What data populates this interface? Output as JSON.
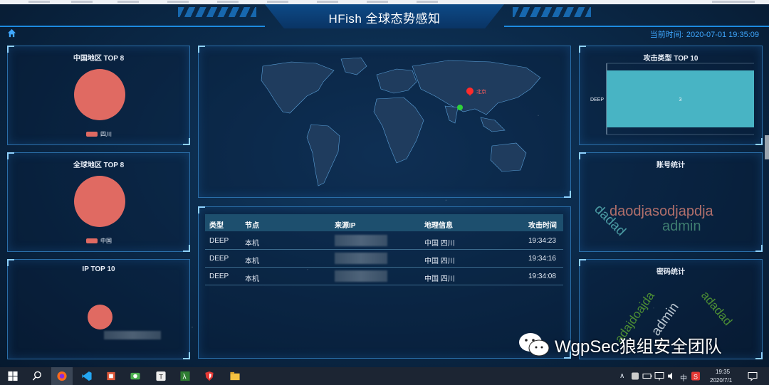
{
  "app": {
    "title": "HFish 全球态势感知"
  },
  "header": {
    "time_label": "当前时间:",
    "time_value": "2020-07-01 19:35:09"
  },
  "china_top": {
    "title": "中国地区 TOP 8",
    "legend": "四川"
  },
  "global_top": {
    "title": "全球地区 TOP 8",
    "legend": "中国"
  },
  "ip_top": {
    "title": "IP TOP 10"
  },
  "attack_type": {
    "title": "攻击类型 TOP 10"
  },
  "account_stats": {
    "title": "账号统计",
    "words": [
      "daodjasodjapdja",
      "dadad",
      "admin"
    ]
  },
  "password_stats": {
    "title": "密码统计",
    "words": [
      "adajdoajda",
      "admin",
      "adadad"
    ]
  },
  "table": {
    "headers": [
      "类型",
      "节点",
      "来源IP",
      "地理信息",
      "攻击时间"
    ],
    "rows": [
      {
        "type": "DEEP",
        "node": "本机",
        "geo": "中国 四川",
        "time": "19:34:23"
      },
      {
        "type": "DEEP",
        "node": "本机",
        "geo": "中国 四川",
        "time": "19:34:16"
      },
      {
        "type": "DEEP",
        "node": "本机",
        "geo": "中国 四川",
        "time": "19:34:08"
      }
    ]
  },
  "map": {
    "marker_label": "北京"
  },
  "watermark": {
    "text": "WgpSec狼组安全团队"
  },
  "taskbar": {
    "time": "19:35",
    "date": "2020/7/1",
    "ime": "中"
  },
  "chart_data": {
    "type": "bar",
    "orientation": "horizontal",
    "categories": [
      "DEEP"
    ],
    "values": [
      3
    ],
    "title": "攻击类型 TOP 10",
    "bar_color": "#48b4c4"
  }
}
